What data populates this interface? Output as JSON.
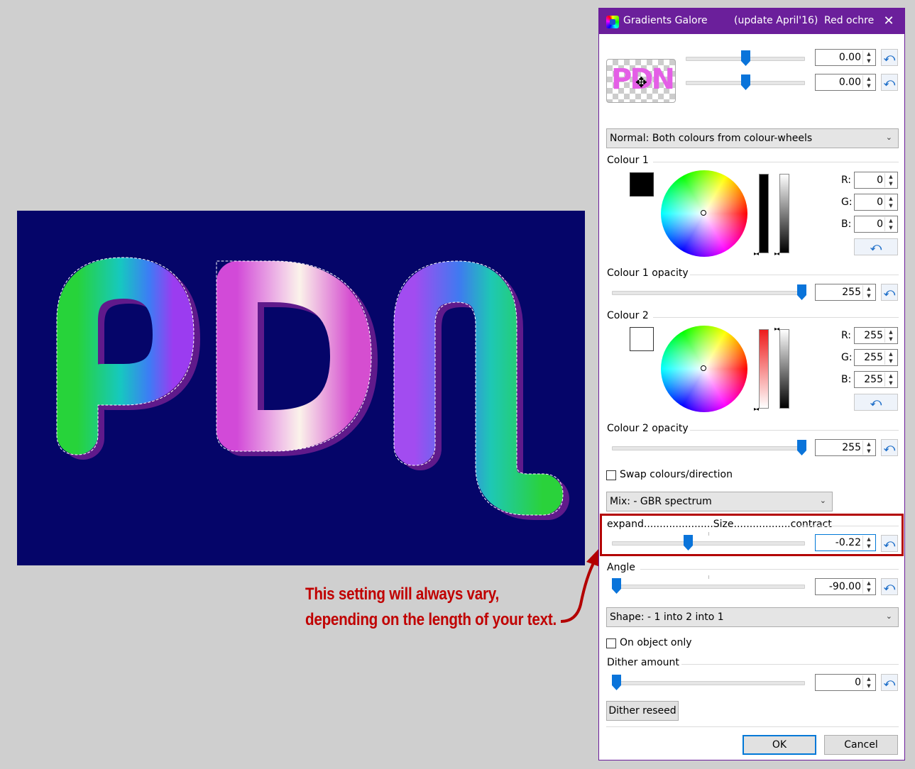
{
  "dialog": {
    "title": "Gradients Galore",
    "subtitle": "(update April'16)",
    "author": "Red ochre",
    "close_glyph": "✕"
  },
  "preview": {
    "text": "PDN"
  },
  "offsets": [
    {
      "value": "0.00"
    },
    {
      "value": "0.00"
    }
  ],
  "mode_select": {
    "selected": "Normal: Both colours from colour-wheels"
  },
  "colour1": {
    "label": "Colour 1",
    "swatch": "#000000",
    "r_label": "R:",
    "g_label": "G:",
    "b_label": "B:",
    "r": "0",
    "g": "0",
    "b": "0"
  },
  "colour1_opacity": {
    "label": "Colour 1 opacity",
    "value": "255"
  },
  "colour2": {
    "label": "Colour 2",
    "swatch": "#ffffff",
    "r_label": "R:",
    "g_label": "G:",
    "b_label": "B:",
    "r": "255",
    "g": "255",
    "b": "255"
  },
  "colour2_opacity": {
    "label": "Colour 2 opacity",
    "value": "255"
  },
  "swap": {
    "label": "Swap colours/direction",
    "checked": false
  },
  "mix_select": {
    "selected": "Mix: - GBR spectrum"
  },
  "size": {
    "label": "expand......................Size..................contract",
    "value": "-0.22"
  },
  "angle": {
    "label": "Angle",
    "value": "-90.00"
  },
  "shape_select": {
    "selected": "Shape: - 1 into 2 into 1"
  },
  "on_object": {
    "label": "On object only",
    "checked": false
  },
  "dither": {
    "label": "Dither amount",
    "value": "0",
    "reseed_label": "Dither reseed"
  },
  "buttons": {
    "ok": "OK",
    "cancel": "Cancel"
  },
  "annotation": {
    "line1": "This setting will always vary,",
    "line2": "depending on the length of your text."
  },
  "canvas": {
    "text": "PDN",
    "background": "#050569"
  },
  "icons": {
    "reset": "reset-arrow-icon",
    "spin_up": "▲",
    "spin_down": "▼",
    "chevron": "⌄",
    "vmark": "▸◂"
  }
}
